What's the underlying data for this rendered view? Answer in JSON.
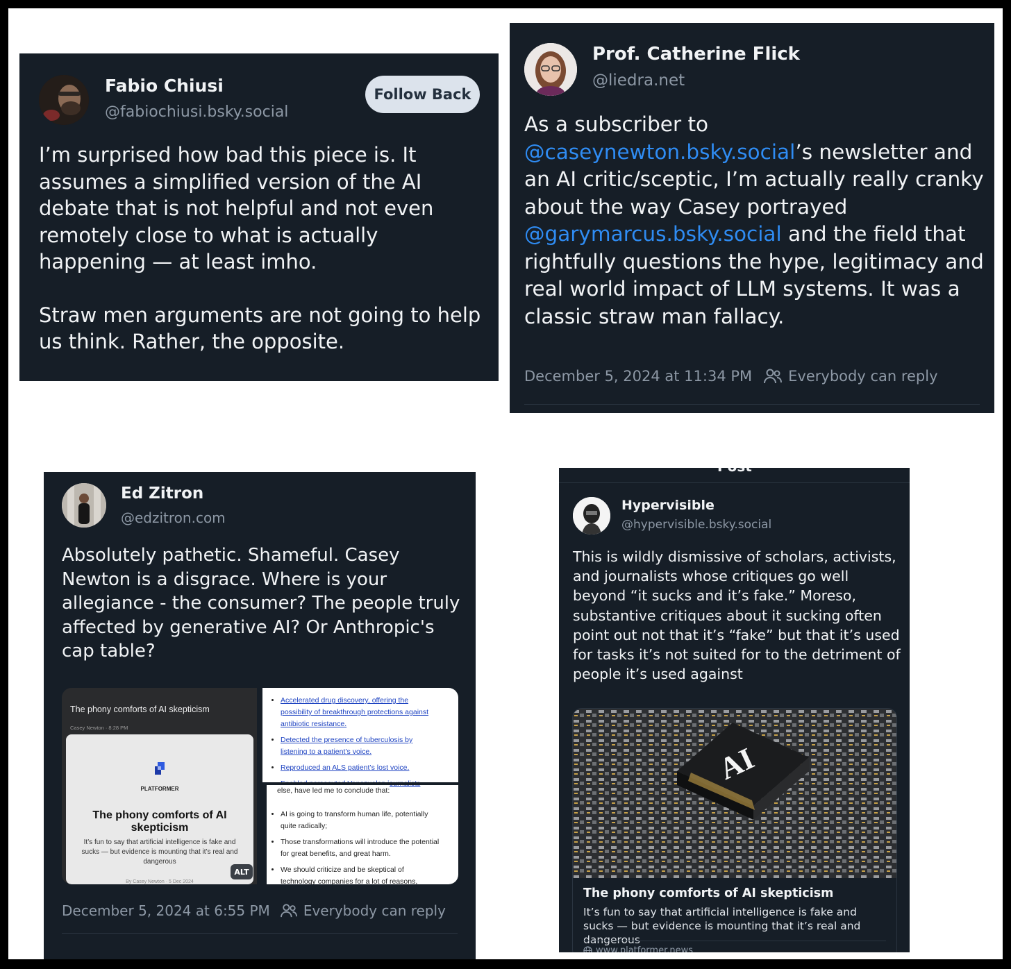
{
  "fabio": {
    "name": "Fabio Chiusi",
    "handle": "@fabiochiusi.bsky.social",
    "follow_label": "Follow Back",
    "para1": "I’m surprised how bad this piece is. It assumes a simplified version of the AI debate that is not helpful and not even remotely close to what is actually happening — at least imho.",
    "para2": "Straw men arguments are not going to help us think. Rather, the opposite."
  },
  "catherine": {
    "name": "Prof. Catherine Flick",
    "handle": "@liedra.net",
    "t1": "As a subscriber to ",
    "m1": "@caseynewton.bsky.social",
    "t2": "’s newsletter and an AI critic/sceptic, I’m actually really cranky about the way Casey portrayed ",
    "m2": "@garymarcus.bsky.social",
    "t3": " and the field that rightfully questions the hype, legitimacy and real world impact of LLM systems. It was a classic straw man fallacy.",
    "timestamp": "December 5, 2024 at 11:34 PM",
    "reply": "Everybody can reply"
  },
  "ed": {
    "name": "Ed Zitron",
    "handle": "@edzitron.com",
    "body": "Absolutely pathetic. Shameful. Casey Newton is a disgrace. Where is your allegiance - the consumer? The people truly affected by generative AI? Or Anthropic's cap table?",
    "timestamp": "December 5, 2024 at 6:55 PM",
    "reply": "Everybody can reply",
    "left_image": {
      "header": "The phony comforts of AI skepticism",
      "byline": "Casey Newton · 8:28 PM",
      "brand": "PLATFORMER",
      "title": "The phony comforts of AI skepticism",
      "desc": "It’s fun to say that artificial intelligence is fake and sucks — but evidence is mounting that it’s real and dangerous",
      "footer": "By Casey Newton · 5 Dec 2024",
      "alt": "ALT"
    },
    "right_image": {
      "links": [
        "Accelerated drug discovery, offering the possibility of breakthrough protections against antibiotic resistance.",
        "Detected the presence of tuberculosis by listening to a patient’s voice.",
        "Reproduced an ALS patient’s lost voice.",
        "Enabled persecuted Venezuelan journalists"
      ],
      "lead": "else, have led me to conclude that:",
      "bullets": [
        "AI is going to transform human life, potentially quite radically;",
        "Those transformations will introduce the potential for great benefits, and great harm.",
        "We should criticize and be skeptical of technology companies for a lot of reasons,"
      ]
    }
  },
  "hyper": {
    "top_title": "Post",
    "name": "Hypervisible",
    "handle": "@hypervisible.bsky.social",
    "body": "This is wildly dismissive of scholars, activists, and journalists whose critiques go well beyond “it sucks and it’s fake.” Moreso, substantive critiques about it sucking often point out not that it’s “fake” but that it’s used for tasks it’s not suited for to the detriment of people it’s used against",
    "chip_text": "AI",
    "link_title": "The phony comforts of AI skepticism",
    "link_desc": "It’s fun to say that artificial intelligence is fake and sucks — but evidence is mounting that it’s real and dangerous",
    "link_domain": "www.platformer.news"
  },
  "colors": {
    "card_bg": "#161e27",
    "mention": "#2f8cf3",
    "meta": "#8d98a5"
  }
}
